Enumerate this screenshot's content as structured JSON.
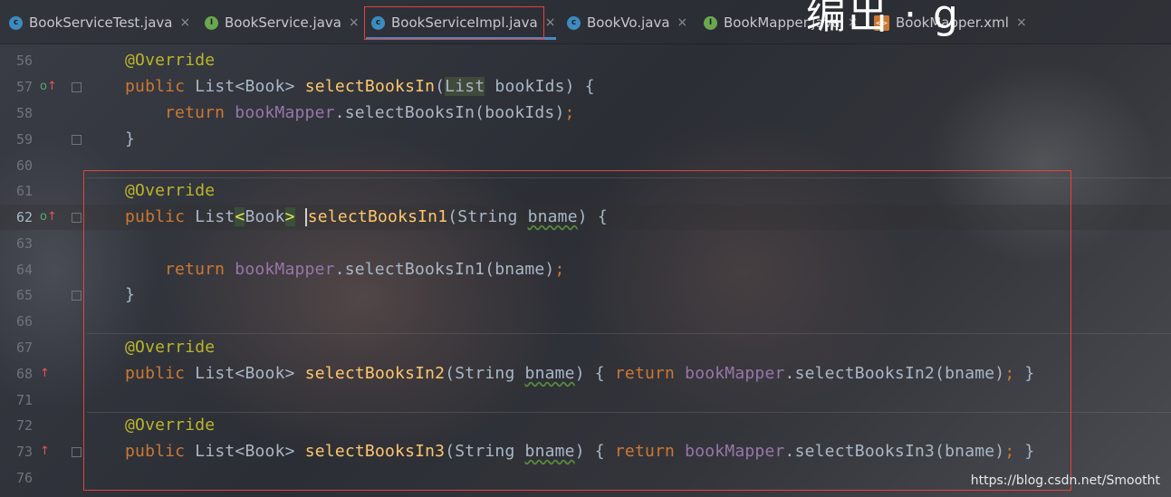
{
  "tabs": [
    {
      "label": "BookServiceTest.java",
      "icon": "class-icon",
      "color": "#3d8bbf"
    },
    {
      "label": "BookService.java",
      "icon": "interface-icon",
      "color": "#6aa84f"
    },
    {
      "label": "BookServiceImpl.java",
      "icon": "class-icon",
      "color": "#3d8bbf",
      "active": true
    },
    {
      "label": "BookVo.java",
      "icon": "class-icon",
      "color": "#3d8bbf"
    },
    {
      "label": "BookMapper.java",
      "icon": "interface-icon",
      "color": "#6aa84f"
    },
    {
      "label": "BookMapper.xml",
      "icon": "xml-file-icon",
      "color": "#cc7832"
    }
  ],
  "tab_close": "×",
  "class_icon_letter": "c",
  "interface_icon_letter": "I",
  "xml_icon_text": "<>",
  "top_right_text": "编出 · g",
  "line_numbers": [
    "56",
    "57",
    "58",
    "59",
    "60",
    "61",
    "62",
    "63",
    "64",
    "65",
    "66",
    "67",
    "68",
    "71",
    "72",
    "73",
    "76"
  ],
  "code": {
    "l56": "@Override",
    "l57": {
      "kw": "public",
      "type1": "List<Book>",
      "fn": "selectBooksIn",
      "p1": "(",
      "list": "List",
      "rest": " bookIds) {"
    },
    "l58": {
      "kw": "return",
      "fld": "bookMapper",
      "rest": ".selectBooksIn(bookIds)",
      "semi": ";"
    },
    "l59": "}",
    "l61": "@Override",
    "l62": {
      "kw": "public",
      "type1": "List",
      "lt": "<",
      "book": "Book",
      "gt": ">",
      "fn": "selectBooksIn1",
      "open": "(String ",
      "param": "bname",
      "close": ") {"
    },
    "l64": {
      "kw": "return",
      "fld": "bookMapper",
      "rest": ".selectBooksIn1(bname)",
      "semi": ";"
    },
    "l65": "}",
    "l67": "@Override",
    "l68": {
      "kw": "public",
      "type1": "List<Book>",
      "fn": "selectBooksIn2",
      "open": "(String ",
      "param": "bname",
      "close": ") { ",
      "ret": "return",
      "fld": "bookMapper",
      "rest": ".selectBooksIn2(bname)",
      "semi": ";",
      "end": " }"
    },
    "l72": "@Override",
    "l73": {
      "kw": "public",
      "type1": "List<Book>",
      "fn": "selectBooksIn3",
      "open": "(String ",
      "param": "bname",
      "close": ") { ",
      "ret": "return",
      "fld": "bookMapper",
      "rest": ".selectBooksIn3(bname)",
      "semi": ";",
      "end": " }"
    }
  },
  "gutter_override_icon": "o",
  "gutter_arrow_icon": "↑",
  "watermark": "https://blog.csdn.net/Smootht"
}
